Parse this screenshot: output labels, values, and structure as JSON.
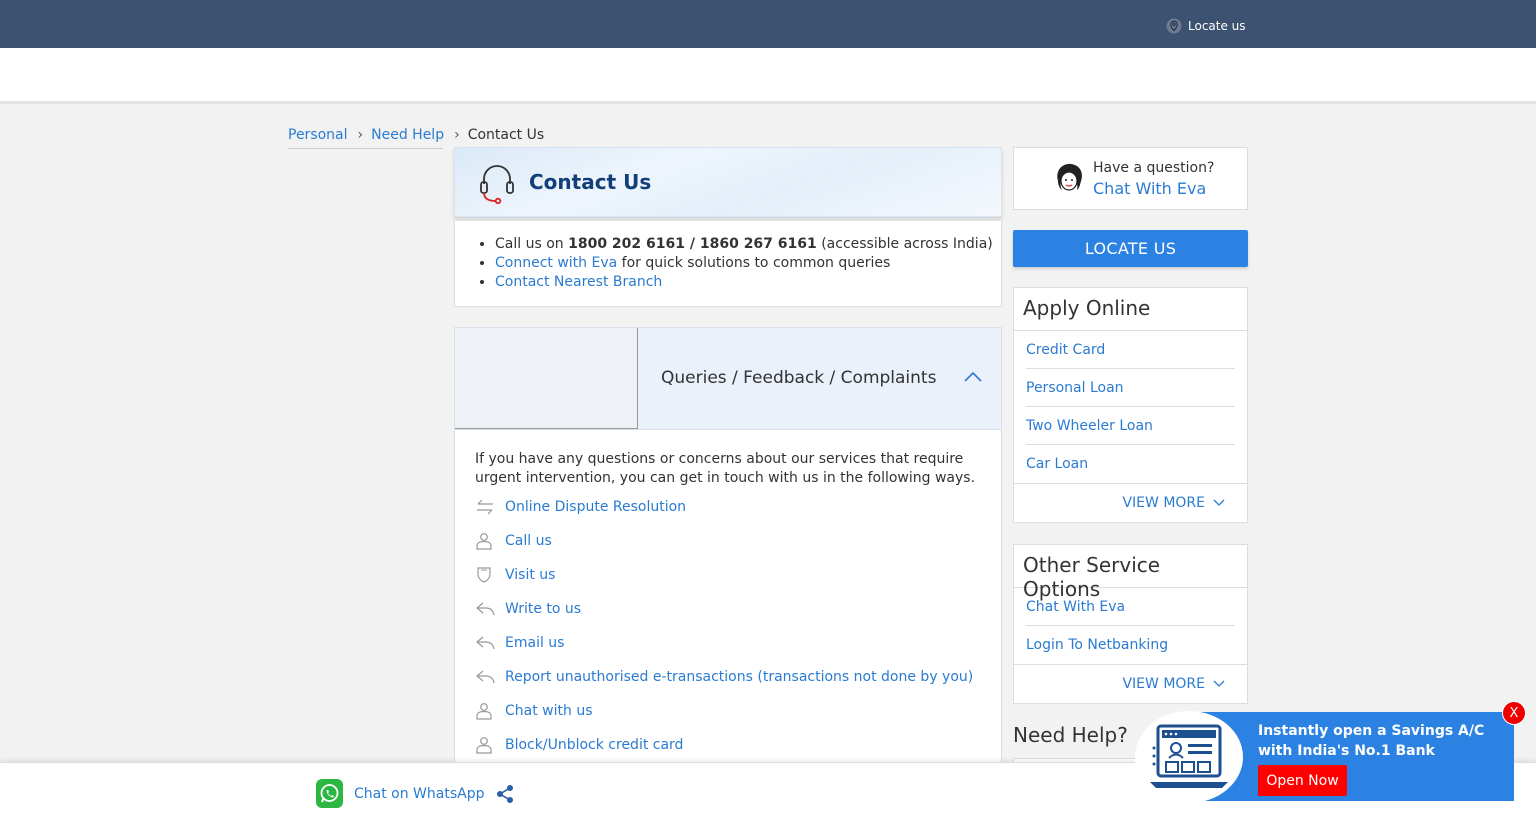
{
  "header": {
    "locate_label": "Locate us"
  },
  "breadcrumb": {
    "items": [
      "Personal",
      "Need Help"
    ],
    "current": "Contact Us"
  },
  "contact": {
    "title": "Contact Us",
    "call_prefix": "Call us on ",
    "call_numbers": "1800 202 6161 / 1860 267 6161",
    "call_suffix": " (accessible across India)",
    "eva_link": "Connect with Eva",
    "eva_suffix": " for quick solutions to common queries",
    "branch_link": "Contact Nearest Branch"
  },
  "queries": {
    "title": "Queries / Feedback / Complaints",
    "intro": "If you have any questions or concerns about our services that require urgent intervention, you can get in touch with us in the following ways.",
    "options": [
      {
        "label": "Online Dispute Resolution",
        "icon": "arrows-exchange-icon"
      },
      {
        "label": "Call us",
        "icon": "person-icon"
      },
      {
        "label": "Visit us",
        "icon": "shield-icon"
      },
      {
        "label": "Write to us",
        "icon": "reply-icon"
      },
      {
        "label": "Email us",
        "icon": "reply-icon"
      },
      {
        "label": "Report unauthorised e-transactions (transactions not done by you)",
        "icon": "reply-icon"
      },
      {
        "label": "Chat with us",
        "icon": "person-icon"
      },
      {
        "label": "Block/Unblock credit card",
        "icon": "person-icon"
      }
    ]
  },
  "sidebar": {
    "eva_question": "Have a question?",
    "eva_link": "Chat With Eva",
    "locate_button": "LOCATE US",
    "apply_online": {
      "title": "Apply Online",
      "items": [
        "Credit Card",
        "Personal Loan",
        "Two Wheeler Loan",
        "Car Loan"
      ],
      "more": "VIEW MORE"
    },
    "other_services": {
      "title": "Other Service Options",
      "items": [
        "Chat With Eva",
        "Login To Netbanking"
      ],
      "more": "VIEW MORE"
    },
    "need_help": "Need Help?"
  },
  "footer": {
    "whatsapp": "Chat on WhatsApp"
  },
  "promo": {
    "text": "Instantly open a Savings A/C with India's No.1 Bank",
    "button": "Open Now",
    "close": "X"
  },
  "colors": {
    "topbar": "#3d5170",
    "link": "#2a7bd1",
    "primary_button": "#2b82e3",
    "promo_button": "#ff0000"
  }
}
